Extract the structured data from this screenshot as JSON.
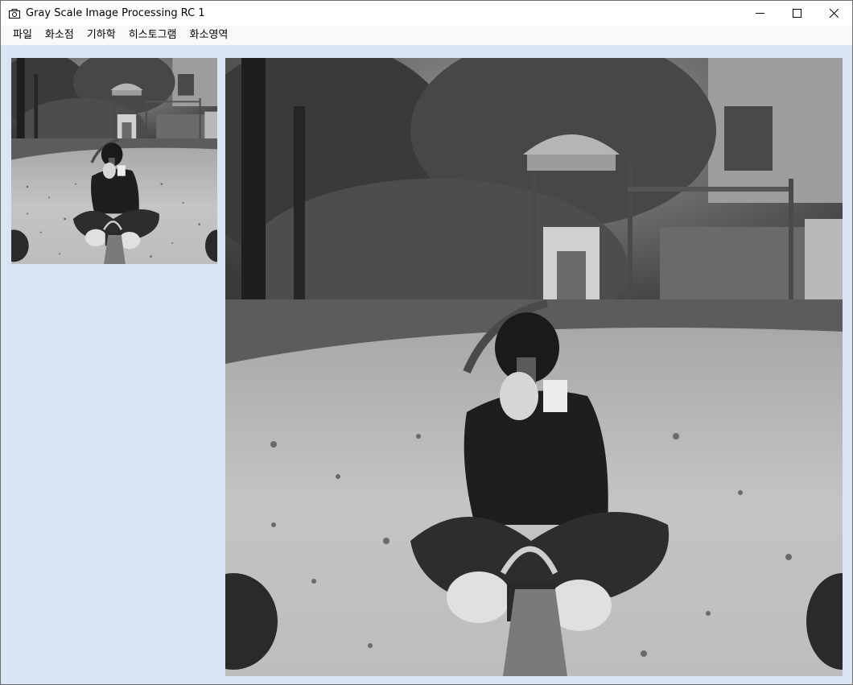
{
  "window": {
    "title": "Gray Scale Image Processing RC 1",
    "app_icon": "camera-icon",
    "controls": {
      "minimize_icon": "minimize-icon",
      "maximize_icon": "maximize-icon",
      "close_icon": "close-icon"
    }
  },
  "menubar": {
    "items": [
      {
        "label": "파일"
      },
      {
        "label": "화소점"
      },
      {
        "label": "기하학"
      },
      {
        "label": "히스토그램"
      },
      {
        "label": "화소영역"
      }
    ]
  },
  "images": {
    "original": {
      "description_icon": "grayscale-photo-thumbnail"
    },
    "processed": {
      "description_icon": "grayscale-photo-enlarged"
    }
  },
  "colors": {
    "client_background": "#d9e5f2",
    "menubar_background": "#f9f9f9",
    "titlebar_background": "#ffffff"
  }
}
